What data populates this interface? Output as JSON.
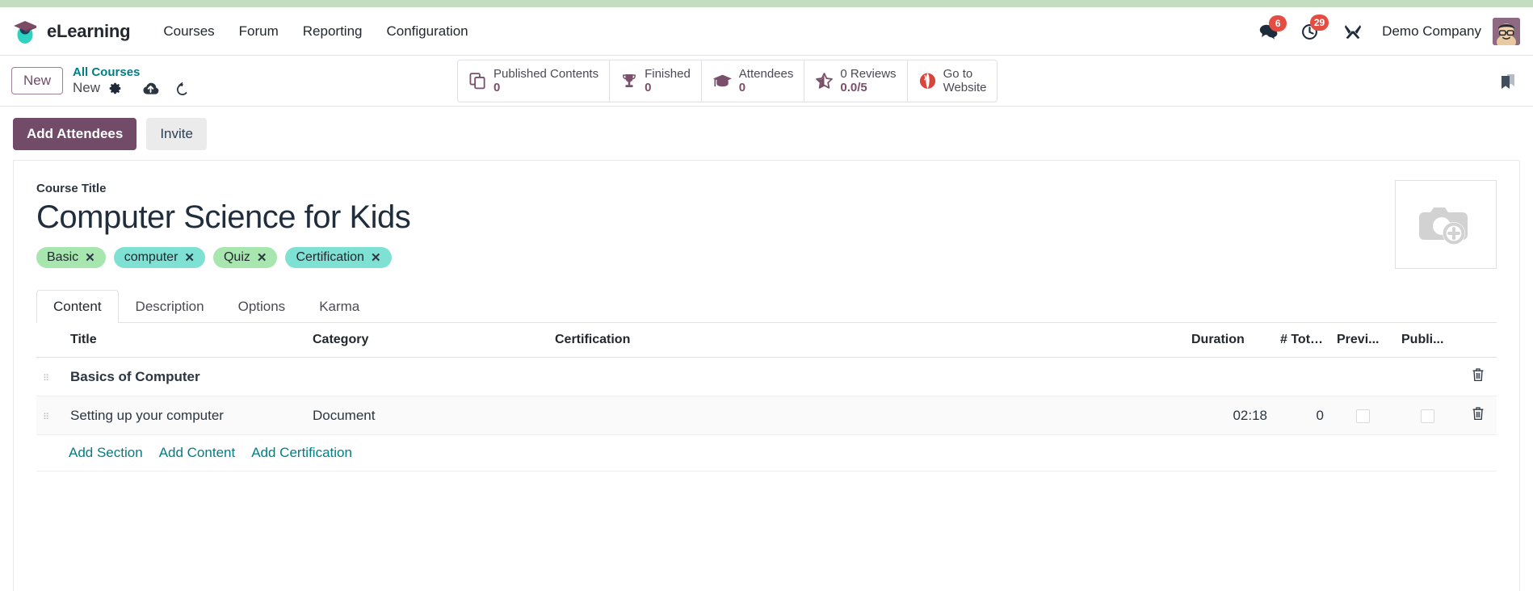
{
  "colors": {
    "top_strip": "#c3ddc0",
    "primary": "#714b67",
    "link": "#017e84",
    "badge": "#e54d42",
    "stat_icon": "#7a4f6c",
    "website_icon": "#d9453a",
    "tag_green": "#a8e6b0",
    "tag_teal": "#7fe0d4"
  },
  "navbar": {
    "brand": "eLearning",
    "brand_logo_icon": "graduation-cap-icon",
    "links": [
      {
        "label": "Courses"
      },
      {
        "label": "Forum"
      },
      {
        "label": "Reporting"
      },
      {
        "label": "Configuration"
      }
    ],
    "messages_icon": "chat-bubbles-icon",
    "messages_count": "6",
    "activities_icon": "clock-icon",
    "activities_count": "29",
    "debug_icon": "tools-icon",
    "company": "Demo Company",
    "avatar_icon": "user-avatar"
  },
  "control_panel": {
    "new_button": "New",
    "breadcrumb_parent": "All Courses",
    "breadcrumb_current": "New",
    "gear_icon": "gear-icon",
    "save_icon": "cloud-upload-icon",
    "discard_icon": "undo-icon",
    "bookmark_icon": "bookmark-icon",
    "stat_buttons": [
      {
        "icon": "documents-icon",
        "label": "Published Contents",
        "value": "0"
      },
      {
        "icon": "trophy-icon",
        "label": "Finished",
        "value": "0"
      },
      {
        "icon": "graduation-cap-icon",
        "label": "Attendees",
        "value": "0"
      },
      {
        "icon": "star-icon",
        "label": "0 Reviews",
        "value": "0.0/5"
      },
      {
        "icon": "globe-icon",
        "label": "Go to",
        "value": "Website"
      }
    ]
  },
  "actions": {
    "add_attendees": "Add Attendees",
    "invite": "Invite"
  },
  "form": {
    "title_label": "Course Title",
    "title_value": "Computer Science for Kids",
    "image_placeholder_icon": "camera-plus-icon",
    "tags": [
      {
        "label": "Basic",
        "color": "#a8e6b0"
      },
      {
        "label": "computer",
        "color": "#7fe0d4"
      },
      {
        "label": "Quiz",
        "color": "#a8e6b0"
      },
      {
        "label": "Certification",
        "color": "#7fe0d4"
      }
    ],
    "tabs": [
      {
        "label": "Content",
        "active": true
      },
      {
        "label": "Description",
        "active": false
      },
      {
        "label": "Options",
        "active": false
      },
      {
        "label": "Karma",
        "active": false
      }
    ]
  },
  "content_table": {
    "headers": {
      "title": "Title",
      "category": "Category",
      "certification": "Certification",
      "duration": "Duration",
      "total": "# Tota...",
      "preview": "Previ...",
      "published": "Publi..."
    },
    "rows": [
      {
        "type": "section",
        "title": "Basics of Computer",
        "category": "",
        "certification": "",
        "duration": "",
        "total": "",
        "preview": null,
        "published": null
      },
      {
        "type": "content",
        "title": "Setting up your computer",
        "category": "Document",
        "certification": "",
        "duration": "02:18",
        "total": "0",
        "preview": false,
        "published": false
      }
    ],
    "add_links": [
      {
        "label": "Add Section"
      },
      {
        "label": "Add Content"
      },
      {
        "label": "Add Certification"
      }
    ],
    "delete_icon": "trash-icon",
    "drag_icon": "drag-handle-icon"
  }
}
